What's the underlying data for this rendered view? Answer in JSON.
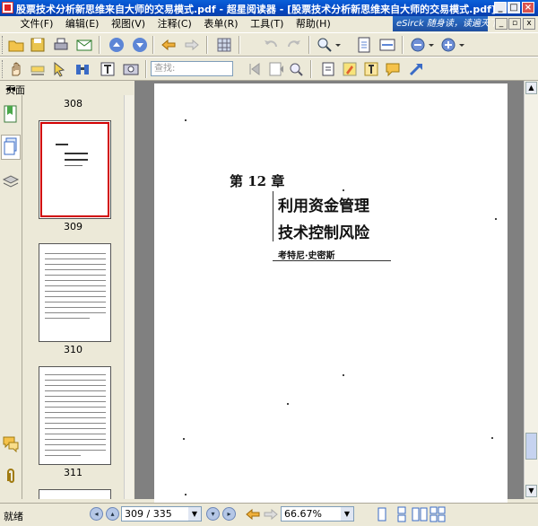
{
  "titlebar": {
    "title": "股票技术分析新思维来自大师的交易模式.pdf - 超星阅读器 - [股票技术分析新思维来自大师的交易模式.pdf]",
    "minimize": "_",
    "maximize": "□",
    "close": "×"
  },
  "menubar": {
    "items": [
      "文件(F)",
      "编辑(E)",
      "视图(V)",
      "注释(C)",
      "表单(R)",
      "工具(T)",
      "帮助(H)"
    ],
    "banner": "eSirck 随身读，读遍天下书！"
  },
  "search": {
    "placeholder": "查找:"
  },
  "panel": {
    "title": "页面",
    "close": "◂◂"
  },
  "thumbnails": [
    {
      "label": "308"
    },
    {
      "label": "309",
      "selected": true
    },
    {
      "label": "310"
    },
    {
      "label": "311"
    }
  ],
  "document": {
    "chapter": "第 12 章",
    "title_line1": "利用资金管理",
    "title_line2": "技术控制风险",
    "author": "考特尼·史密斯"
  },
  "statusbar": {
    "status": "就绪",
    "page_indicator": "309 / 335",
    "zoom": "66.67%"
  },
  "colors": {
    "titlebar": "#0348c4",
    "selection": "#d10000",
    "doc_background": "#808080"
  }
}
